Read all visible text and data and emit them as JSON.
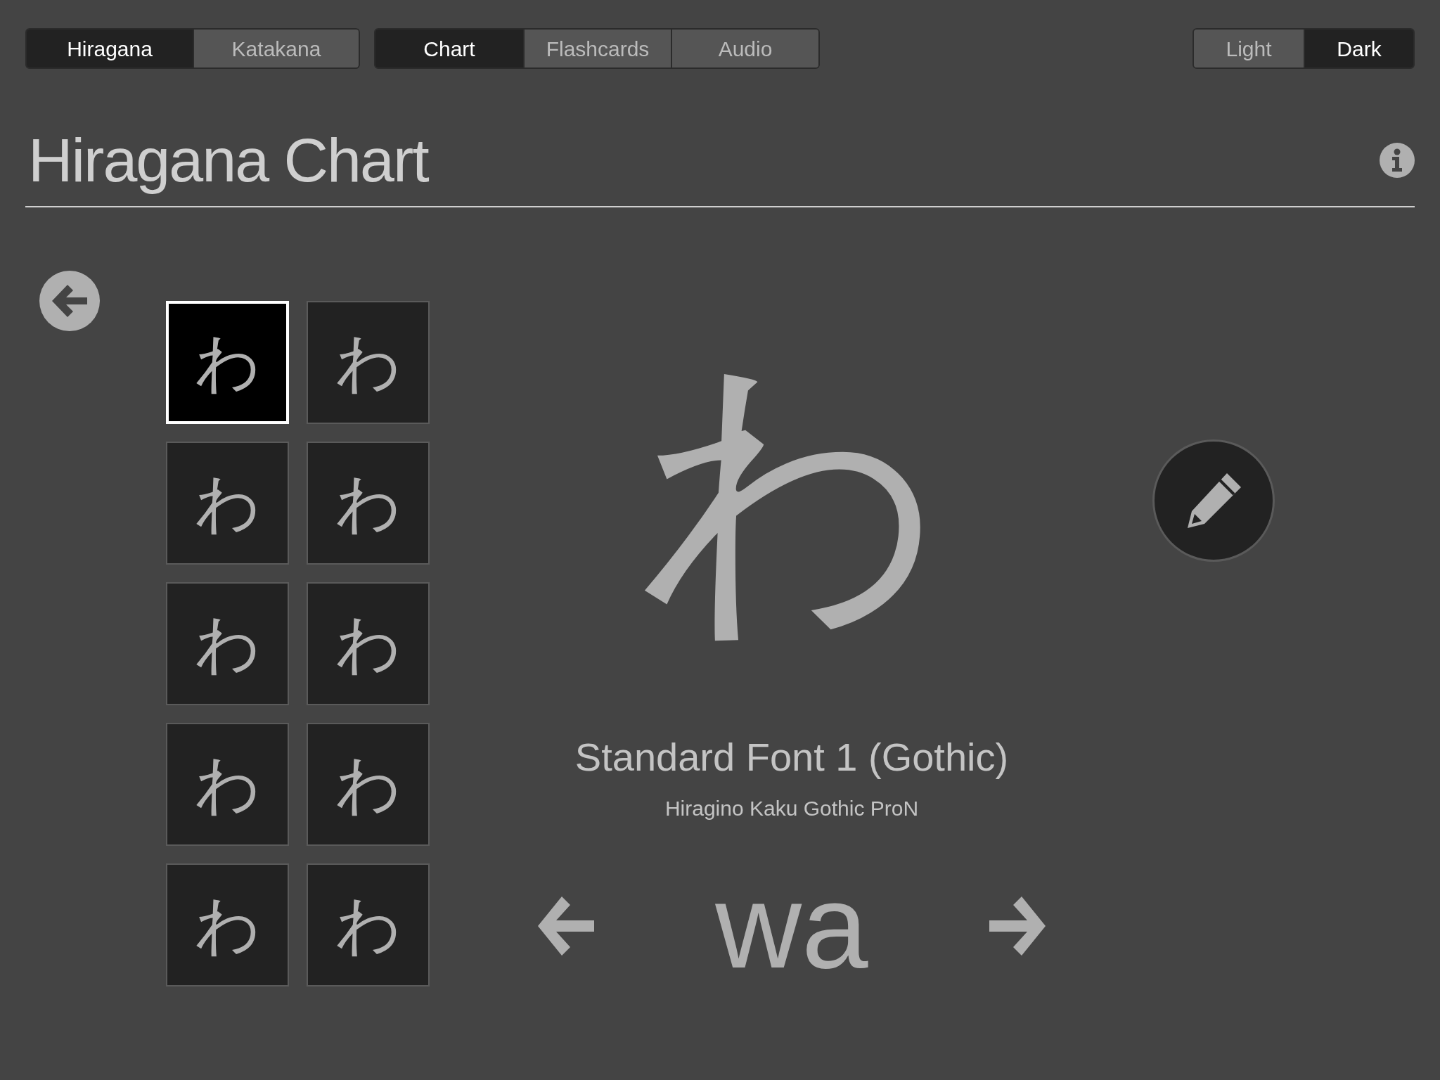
{
  "segment_groups": [
    {
      "options": [
        {
          "label": "Hiragana",
          "selected": true
        },
        {
          "label": "Katakana",
          "selected": false
        }
      ]
    },
    {
      "options": [
        {
          "label": "Chart",
          "selected": true
        },
        {
          "label": "Flashcards",
          "selected": false
        },
        {
          "label": "Audio",
          "selected": false
        }
      ]
    },
    {
      "options": [
        {
          "label": "Light",
          "selected": false
        },
        {
          "label": "Dark",
          "selected": true
        }
      ]
    }
  ],
  "title": "Hiragana Chart",
  "tiles": [
    {
      "glyph": "わ",
      "selected": true
    },
    {
      "glyph": "わ",
      "selected": false
    },
    {
      "glyph": "わ",
      "selected": false
    },
    {
      "glyph": "わ",
      "selected": false
    },
    {
      "glyph": "わ",
      "selected": false
    },
    {
      "glyph": "わ",
      "selected": false
    },
    {
      "glyph": "わ",
      "selected": false
    },
    {
      "glyph": "わ",
      "selected": false
    },
    {
      "glyph": "わ",
      "selected": false
    },
    {
      "glyph": "わ",
      "selected": false
    }
  ],
  "character": "わ",
  "font_name": "Standard Font 1 (Gothic)",
  "font_family": "Hiragino Kaku Gothic ProN",
  "romaji": "wa"
}
